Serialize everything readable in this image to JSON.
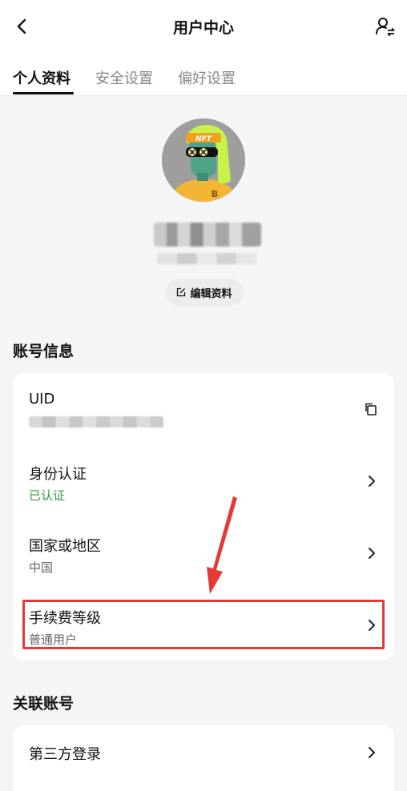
{
  "header": {
    "title": "用户中心"
  },
  "tabs": [
    {
      "label": "个人资料",
      "active": true
    },
    {
      "label": "安全设置",
      "active": false
    },
    {
      "label": "偏好设置",
      "active": false
    }
  ],
  "profile": {
    "avatar_badge_text": "NFT",
    "avatar_coin_symbol": "B",
    "edit_label": "编辑资料"
  },
  "account_info": {
    "section_title": "账号信息",
    "rows": [
      {
        "title": "UID",
        "sub": ""
      },
      {
        "title": "身份认证",
        "sub": "已认证"
      },
      {
        "title": "国家或地区",
        "sub": "中国"
      },
      {
        "title": "手续费等级",
        "sub": "普通用户"
      }
    ]
  },
  "linked_accounts": {
    "section_title": "关联账号",
    "rows": [
      {
        "title": "第三方登录"
      }
    ]
  },
  "colors": {
    "verified_green": "#2e9e3e",
    "annotation_red": "#e53935",
    "avatar_yellow": "#f3b534",
    "avatar_lime": "#c6f24a"
  }
}
